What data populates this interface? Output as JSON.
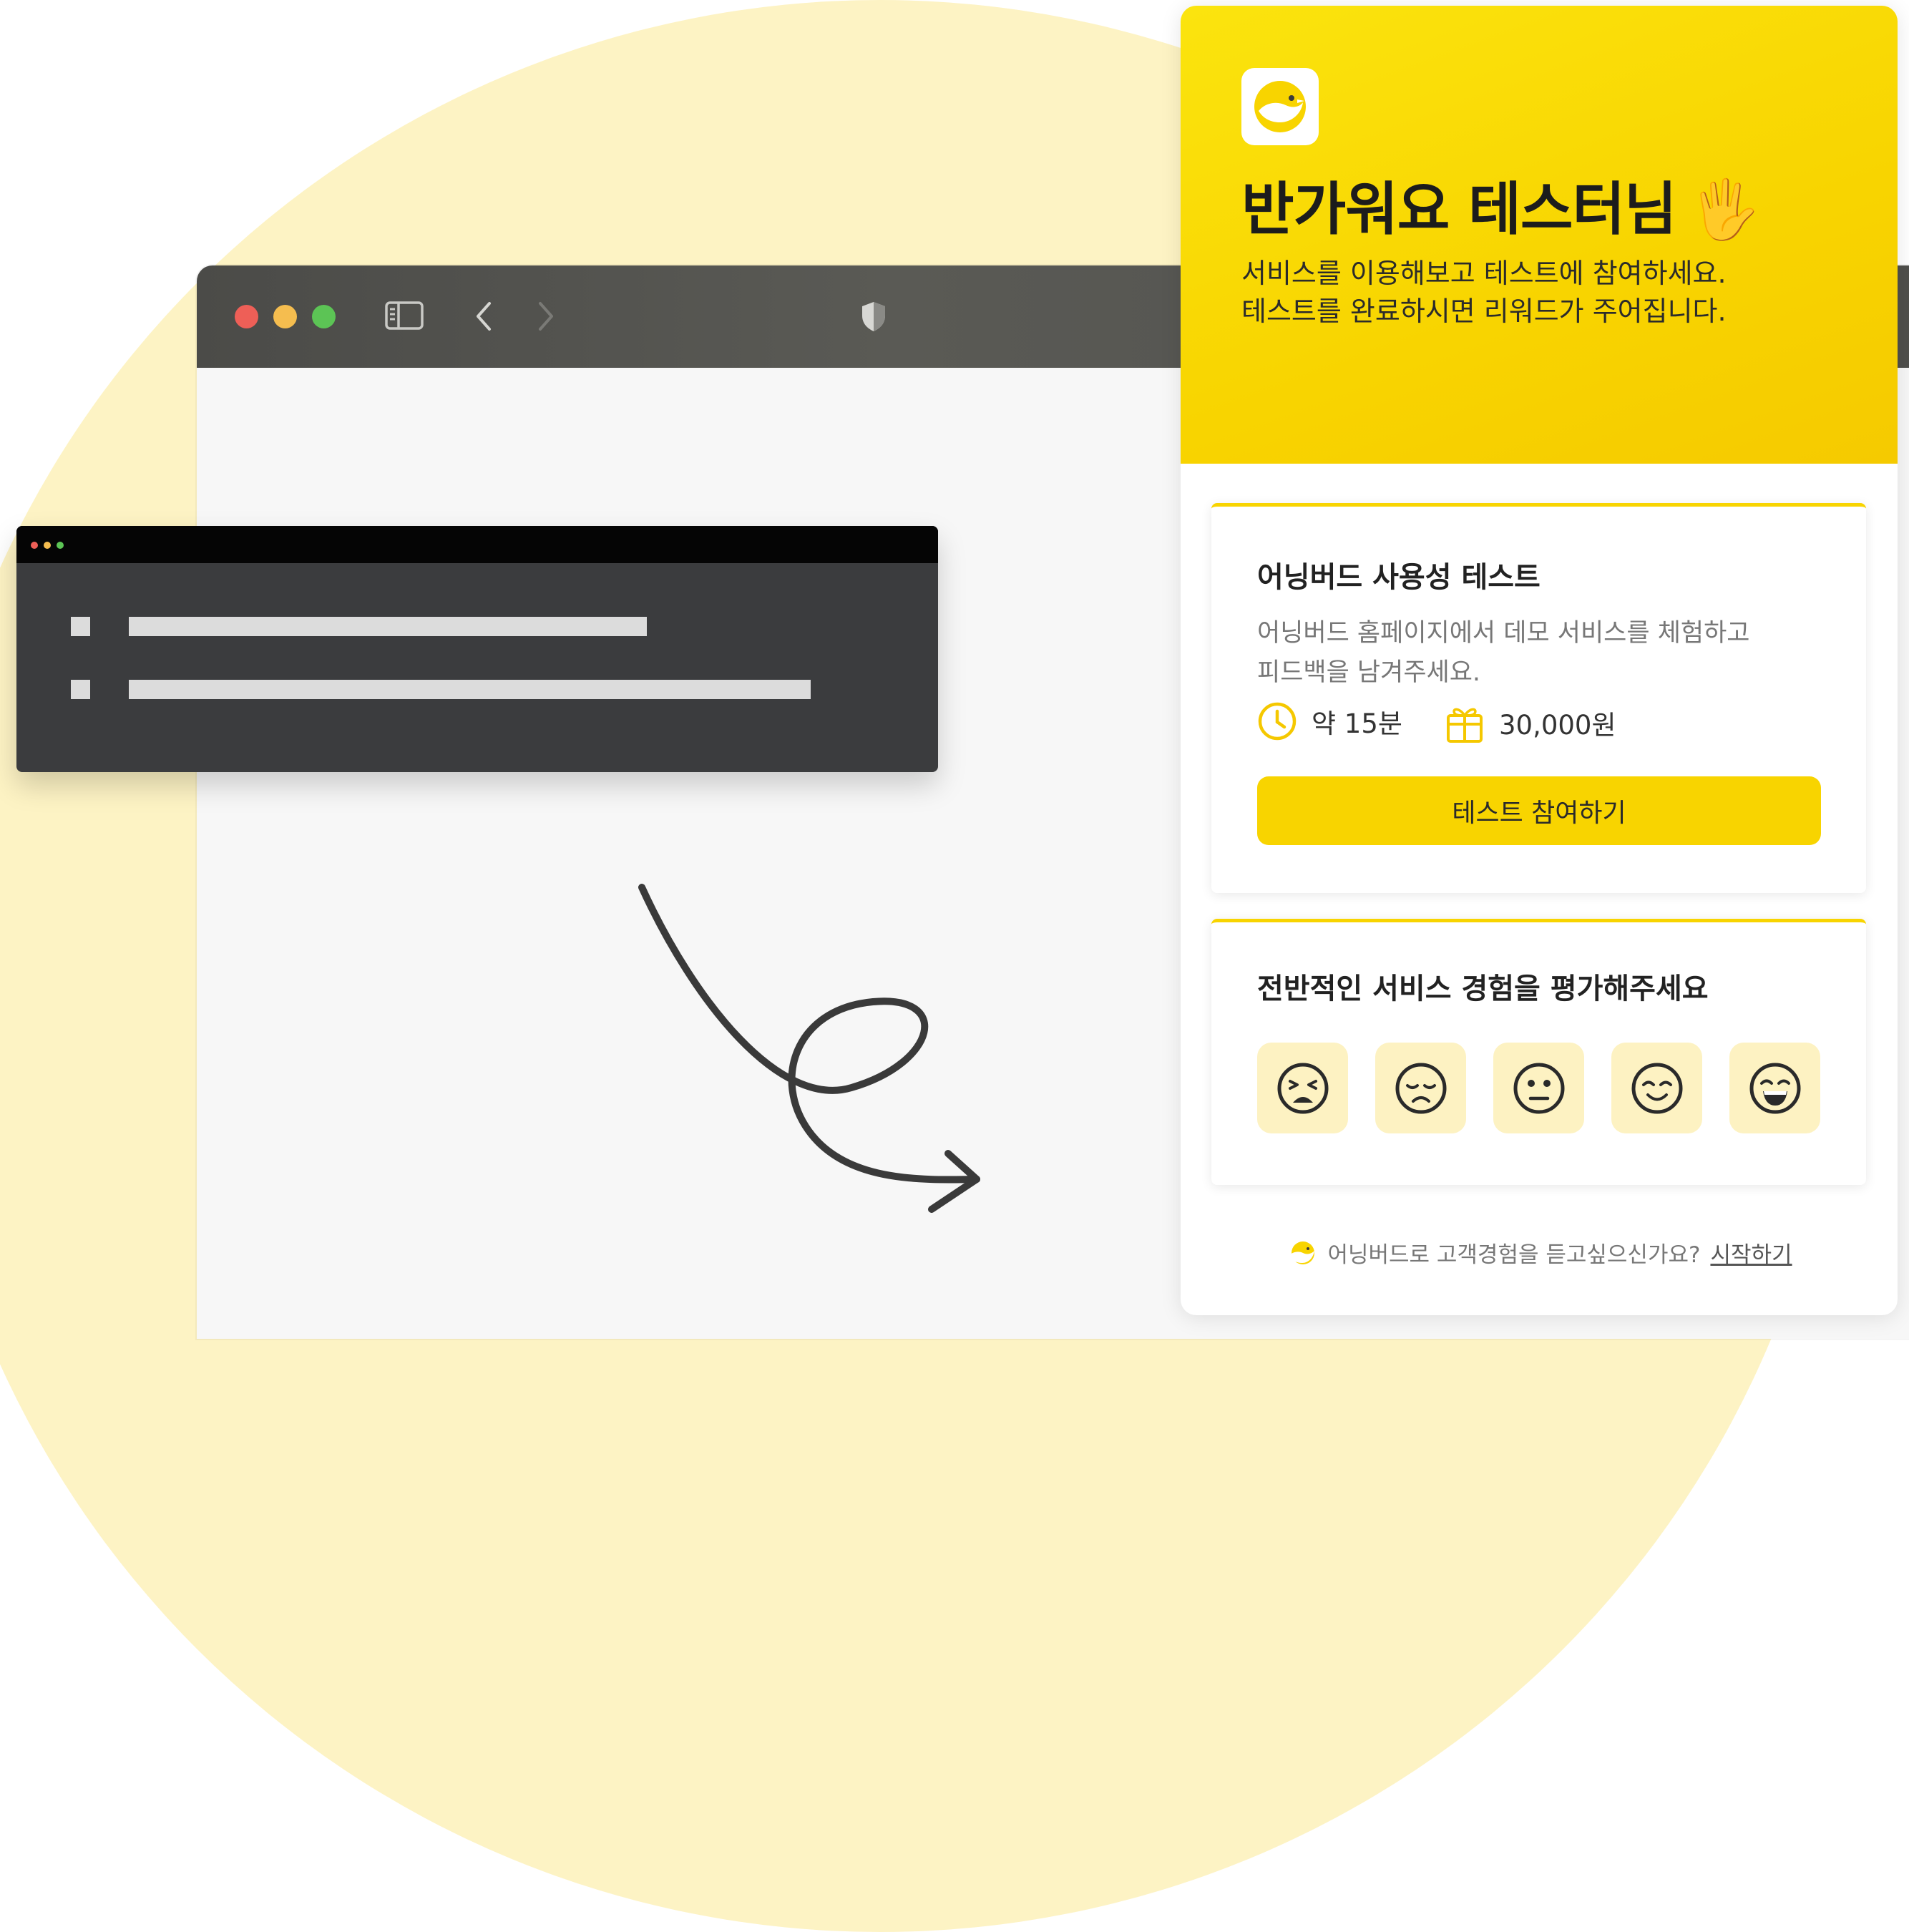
{
  "widget": {
    "title": "반가워요 테스터님",
    "wave_emoji": "🖐",
    "subtitle": "서비스를 이용해보고 테스트에 참여하세요.\n테스트를 완료하시면 리워드가 주어집니다.",
    "logo_icon": "bird-logo-icon",
    "accent_color": "#f8d400"
  },
  "test_card": {
    "title": "어닝버드 사용성 테스트",
    "description": "어닝버드 홈페이지에서 데모 서비스를 체험하고\n피드백을 남겨주세요.",
    "duration": "약 15분",
    "reward": "30,000원",
    "button_label": "테스트 참여하기"
  },
  "rating_card": {
    "title": "전반적인 서비스 경험을 평가해주세요",
    "options": [
      "angry-face-icon",
      "sad-face-icon",
      "neutral-face-icon",
      "smile-face-icon",
      "grin-face-icon"
    ]
  },
  "footer": {
    "text": "어닝버드로 고객경험을 듣고싶으신가요?",
    "link": "시작하기"
  }
}
